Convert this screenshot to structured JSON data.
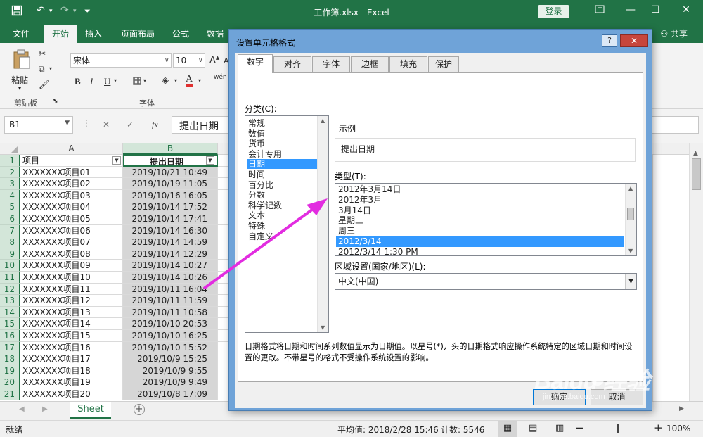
{
  "window": {
    "title": "工作簿.xlsx  -  Excel",
    "login": "登录",
    "share": "共享"
  },
  "tabs": [
    "文件",
    "开始",
    "插入",
    "页面布局",
    "公式",
    "数据"
  ],
  "ribbon": {
    "paste_label": "粘贴",
    "clipboard_group": "剪贴板",
    "font_group": "字体",
    "font_name": "宋体",
    "font_size": "10",
    "bold": "B",
    "italic": "I",
    "underline": "U",
    "font_color_letter": "A",
    "grow_font": "A",
    "shrink_font": "A",
    "phonetic": "wén"
  },
  "formula_bar": {
    "name_box": "B1",
    "fx": "fx",
    "content": "提出日期"
  },
  "sheet": {
    "columns": [
      "A",
      "B"
    ],
    "header_row": [
      "项目",
      "提出日期"
    ],
    "rows": [
      {
        "n": "1"
      },
      {
        "n": "2",
        "a": "XXXXXXX项目01",
        "b": "2019/10/21 10:49"
      },
      {
        "n": "3",
        "a": "XXXXXXX项目02",
        "b": "2019/10/19 11:05"
      },
      {
        "n": "4",
        "a": "XXXXXXX项目03",
        "b": "2019/10/16 16:05"
      },
      {
        "n": "5",
        "a": "XXXXXXX项目04",
        "b": "2019/10/14 17:52"
      },
      {
        "n": "6",
        "a": "XXXXXXX项目05",
        "b": "2019/10/14 17:41"
      },
      {
        "n": "7",
        "a": "XXXXXXX项目06",
        "b": "2019/10/14 16:30"
      },
      {
        "n": "8",
        "a": "XXXXXXX项目07",
        "b": "2019/10/14 14:59"
      },
      {
        "n": "9",
        "a": "XXXXXXX项目08",
        "b": "2019/10/14 12:29"
      },
      {
        "n": "10",
        "a": "XXXXXXX项目09",
        "b": "2019/10/14 10:27"
      },
      {
        "n": "11",
        "a": "XXXXXXX项目10",
        "b": "2019/10/14 10:26"
      },
      {
        "n": "12",
        "a": "XXXXXXX项目11",
        "b": "2019/10/11 16:04"
      },
      {
        "n": "13",
        "a": "XXXXXXX项目12",
        "b": "2019/10/11 11:59"
      },
      {
        "n": "14",
        "a": "XXXXXXX项目13",
        "b": "2019/10/11 10:58"
      },
      {
        "n": "15",
        "a": "XXXXXXX项目14",
        "b": "2019/10/10 20:53"
      },
      {
        "n": "16",
        "a": "XXXXXXX项目15",
        "b": "2019/10/10 16:25"
      },
      {
        "n": "17",
        "a": "XXXXXXX项目16",
        "b": "2019/10/10 15:52"
      },
      {
        "n": "18",
        "a": "XXXXXXX项目17",
        "b": "2019/10/9 15:25"
      },
      {
        "n": "19",
        "a": "XXXXXXX项目18",
        "b": "2019/10/9 9:55"
      },
      {
        "n": "20",
        "a": "XXXXXXX项目19",
        "b": "2019/10/9 9:49"
      },
      {
        "n": "21",
        "a": "XXXXXXX项目20",
        "b": "2019/10/8 17:09"
      }
    ],
    "sheet_tab": "Sheet"
  },
  "status": {
    "ready": "就绪",
    "average": "平均值: 2018/2/28 15:46",
    "count": "计数: 5546",
    "zoom": "100%"
  },
  "dialog": {
    "title": "设置单元格格式",
    "help": "?",
    "close": "✕",
    "tabs": [
      "数字",
      "对齐",
      "字体",
      "边框",
      "填充",
      "保护"
    ],
    "category_label": "分类(C):",
    "categories": [
      "常规",
      "数值",
      "货币",
      "会计专用",
      "日期",
      "时间",
      "百分比",
      "分数",
      "科学记数",
      "文本",
      "特殊",
      "自定义"
    ],
    "selected_category": "日期",
    "sample_label": "示例",
    "sample_value": "提出日期",
    "type_label": "类型(T):",
    "types": [
      "2012年3月14日",
      "2012年3月",
      "3月14日",
      "星期三",
      "周三",
      "2012/3/14",
      "2012/3/14 1:30 PM"
    ],
    "selected_type": "2012/3/14",
    "locale_label": "区域设置(国家/地区)(L):",
    "locale_value": "中文(中国)",
    "description": "日期格式将日期和时间系列数值显示为日期值。以星号(*)开头的日期格式响应操作系统特定的区域日期和时间设置的更改。不带星号的格式不受操作系统设置的影响。",
    "ok": "确定",
    "cancel": "取消"
  },
  "watermark": {
    "brand": "Baidu 经验",
    "url": "jingyan.baidu.com"
  },
  "colors": {
    "excel_green": "#217346",
    "selection_blue": "#3399ff",
    "arrow_magenta": "#e22ce0"
  }
}
